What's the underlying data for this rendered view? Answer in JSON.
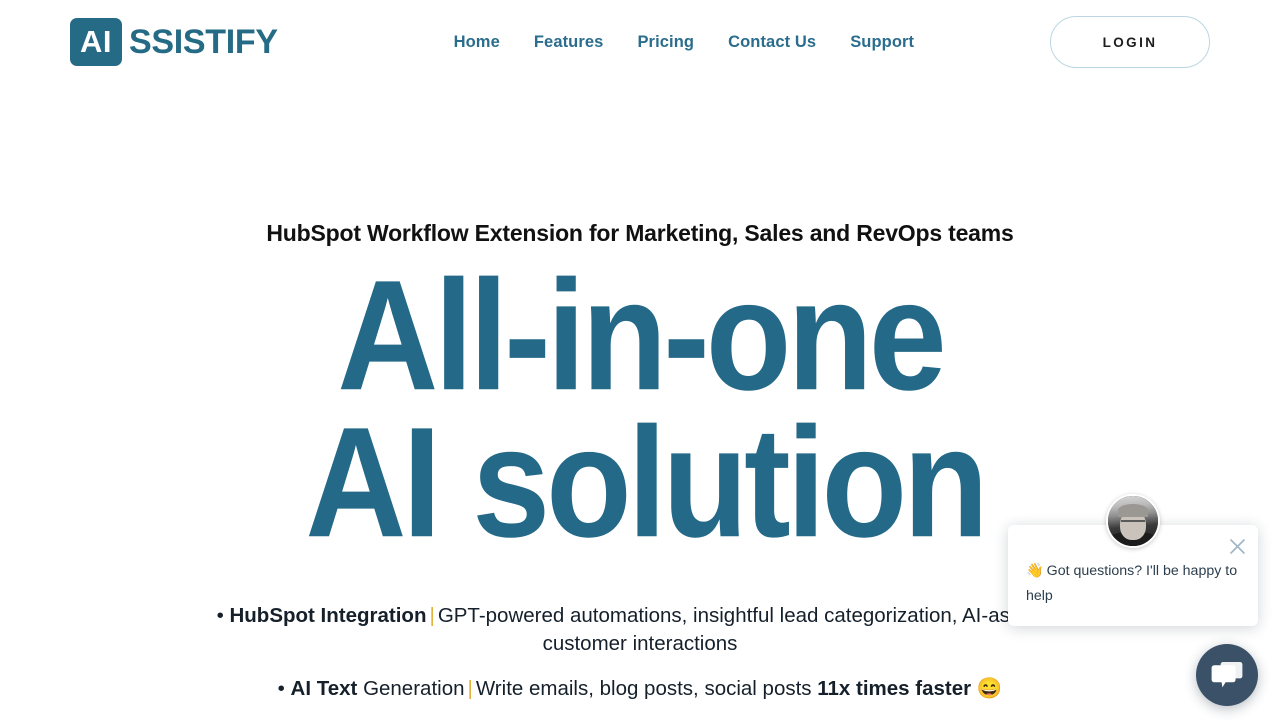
{
  "header": {
    "logo": {
      "badge": "AI",
      "word": "SSISTIFY"
    },
    "nav": [
      {
        "label": "Home"
      },
      {
        "label": "Features"
      },
      {
        "label": "Pricing"
      },
      {
        "label": "Contact Us"
      },
      {
        "label": "Support"
      }
    ],
    "login_label": "LOGIN",
    "brand_color": "#256B85"
  },
  "hero": {
    "eyebrow": "HubSpot Workflow Extension for Marketing, Sales and RevOps teams",
    "title_line_1": "All-in-one",
    "title_line_2": "AI solution",
    "title_color": "#246A88",
    "bullets": [
      {
        "bullet_mark": "•",
        "strong": "HubSpot Integration",
        "separator": "|",
        "rest": "GPT-powered automations, insightful lead categorization, AI-assisted customer interactions"
      },
      {
        "bullet_mark": "•",
        "strong": "AI Text",
        "mid": "Generation",
        "separator": "|",
        "rest_pre": "Write emails, blog posts, social posts",
        "rest_strong": "11x times faster",
        "emoji": "😄"
      }
    ],
    "separator_color": "#E3B23C"
  },
  "chat_widget": {
    "message": "Got questions? I'll be happy to help",
    "wave_emoji": "👋",
    "close_label": "close-chat",
    "launcher_label": "open-chat",
    "launcher_color": "#3A5168"
  }
}
